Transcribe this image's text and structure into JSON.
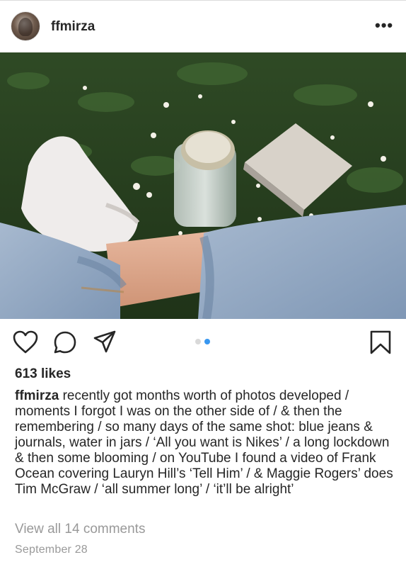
{
  "post": {
    "username": "ffmirza",
    "more_label": "•••",
    "likes": "613 likes",
    "caption_user": "ffmirza",
    "caption_text": " recently got months worth of photos developed / moments I forgot I was on the other side of / & then the remembering / so many days of the same shot: blue jeans & journals, water in jars / ‘All you want is Nikes’ / a long lockdown & then some blooming / on YouTube I found a video of Frank Ocean covering Lauryn Hill’s ‘Tell Him’ / & Maggie Rogers’ does Tim McGraw / ‘all summer long’ / ‘it’ll be alright’",
    "view_comments": "View all 14 comments",
    "date": "September 28"
  },
  "carousel": {
    "total": 2,
    "active": 2
  },
  "icons": {
    "avatar": "profile-photo",
    "more": "more-options-icon",
    "like": "heart-icon",
    "comment": "comment-bubble-icon",
    "share": "paper-plane-icon",
    "save": "bookmark-icon"
  },
  "colors": {
    "text": "#262626",
    "secondary": "#999999",
    "carousel_active": "#3897f0",
    "carousel_inactive": "#d9d9d9"
  }
}
